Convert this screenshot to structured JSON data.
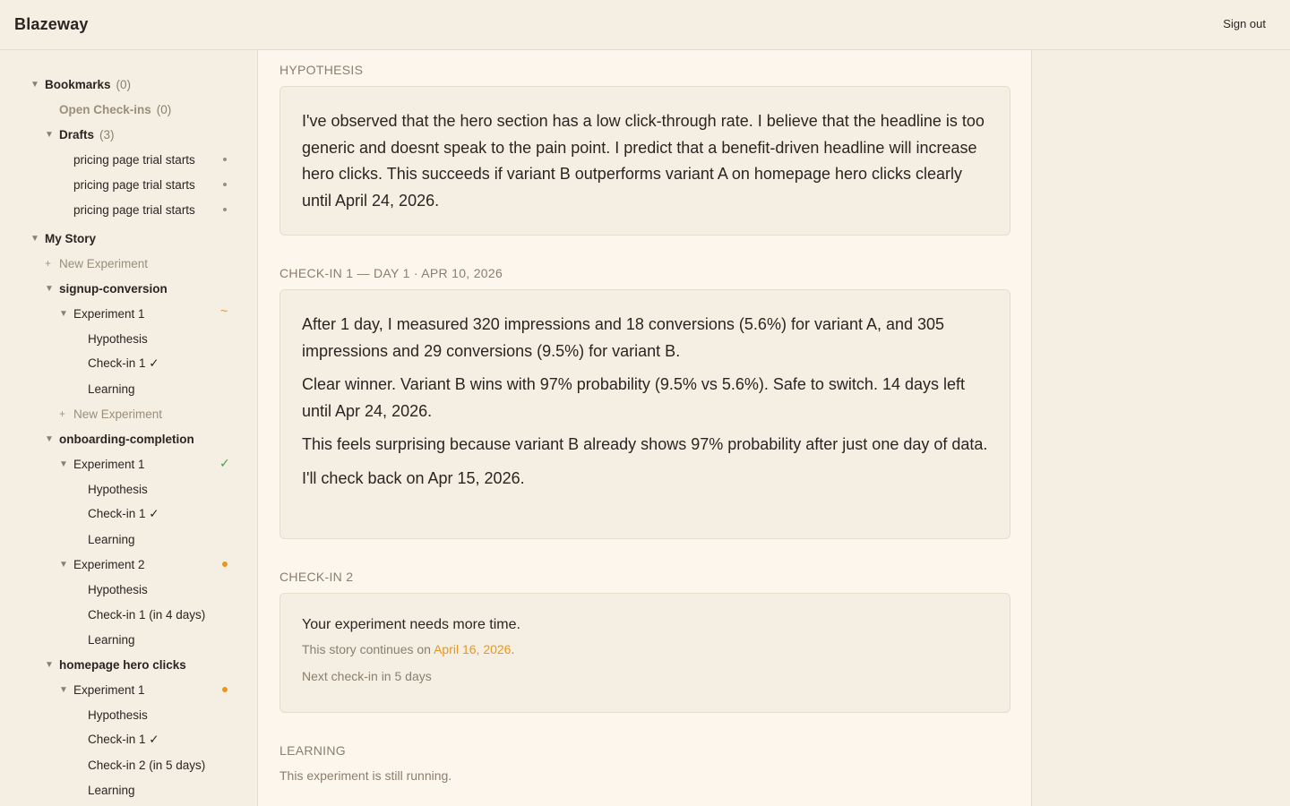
{
  "header": {
    "brand": "Blazeway",
    "signout_label": "Sign out"
  },
  "sidebar": {
    "bookmarks": {
      "label": "Bookmarks",
      "count": "(0)"
    },
    "open_checkins": {
      "label": "Open Check-ins",
      "count": "(0)"
    },
    "drafts": {
      "label": "Drafts",
      "count": "(3)",
      "items": [
        "pricing page trial starts",
        "pricing page trial starts",
        "pricing page trial starts"
      ]
    },
    "my_story": "My Story",
    "new_experiment": "New Experiment",
    "groups": [
      {
        "name": "signup-conversion",
        "experiments": [
          {
            "name": "Experiment 1",
            "status": "running",
            "steps": [
              "Hypothesis",
              "Check-in 1 ✓",
              "Learning"
            ]
          }
        ],
        "new_experiment": "New Experiment"
      },
      {
        "name": "onboarding-completion",
        "experiments": [
          {
            "name": "Experiment 1",
            "status": "done",
            "steps": [
              "Hypothesis",
              "Check-in 1 ✓",
              "Learning"
            ]
          },
          {
            "name": "Experiment 2",
            "status": "active",
            "steps": [
              "Hypothesis",
              "Check-in 1 (in 4 days)",
              "Learning"
            ]
          }
        ]
      },
      {
        "name": "homepage hero clicks",
        "experiments": [
          {
            "name": "Experiment 1",
            "status": "active",
            "steps": [
              "Hypothesis",
              "Check-in 1 ✓",
              "Check-in 2 (in 5 days)",
              "Learning"
            ]
          }
        ]
      }
    ]
  },
  "main": {
    "hypothesis": {
      "label": "HYPOTHESIS",
      "text": "I've observed that the hero section has a low click-through rate. I believe that the headline is too generic and doesnt speak to the pain point. I predict that a benefit-driven headline will increase hero clicks. This succeeds if variant B outperforms variant A on homepage hero clicks clearly until April 24, 2026."
    },
    "checkin1": {
      "label": "CHECK-IN 1 — DAY 1 · APR 10, 2026",
      "paragraphs": [
        "After 1 day, I measured 320 impressions and 18 conversions (5.6%) for variant A, and 305 impressions and 29 conversions (9.5%) for variant B.",
        "Clear winner. Variant B wins with 97% probability (9.5% vs 5.6%). Safe to switch. 14 days left until Apr 24, 2026.",
        "This feels surprising because variant B already shows 97% probability after just one day of data.",
        "I'll check back on Apr 15, 2026."
      ]
    },
    "checkin2": {
      "label": "CHECK-IN 2",
      "title": "Your experiment needs more time.",
      "continues_prefix": "This story continues on ",
      "continues_date": "April 16, 2026",
      "continues_suffix": ".",
      "next": "Next check-in in 5 days"
    },
    "learning": {
      "label": "LEARNING",
      "text": "This experiment is still running."
    },
    "colors": {
      "accent": "#e8971e",
      "success": "#3fa34d"
    }
  }
}
